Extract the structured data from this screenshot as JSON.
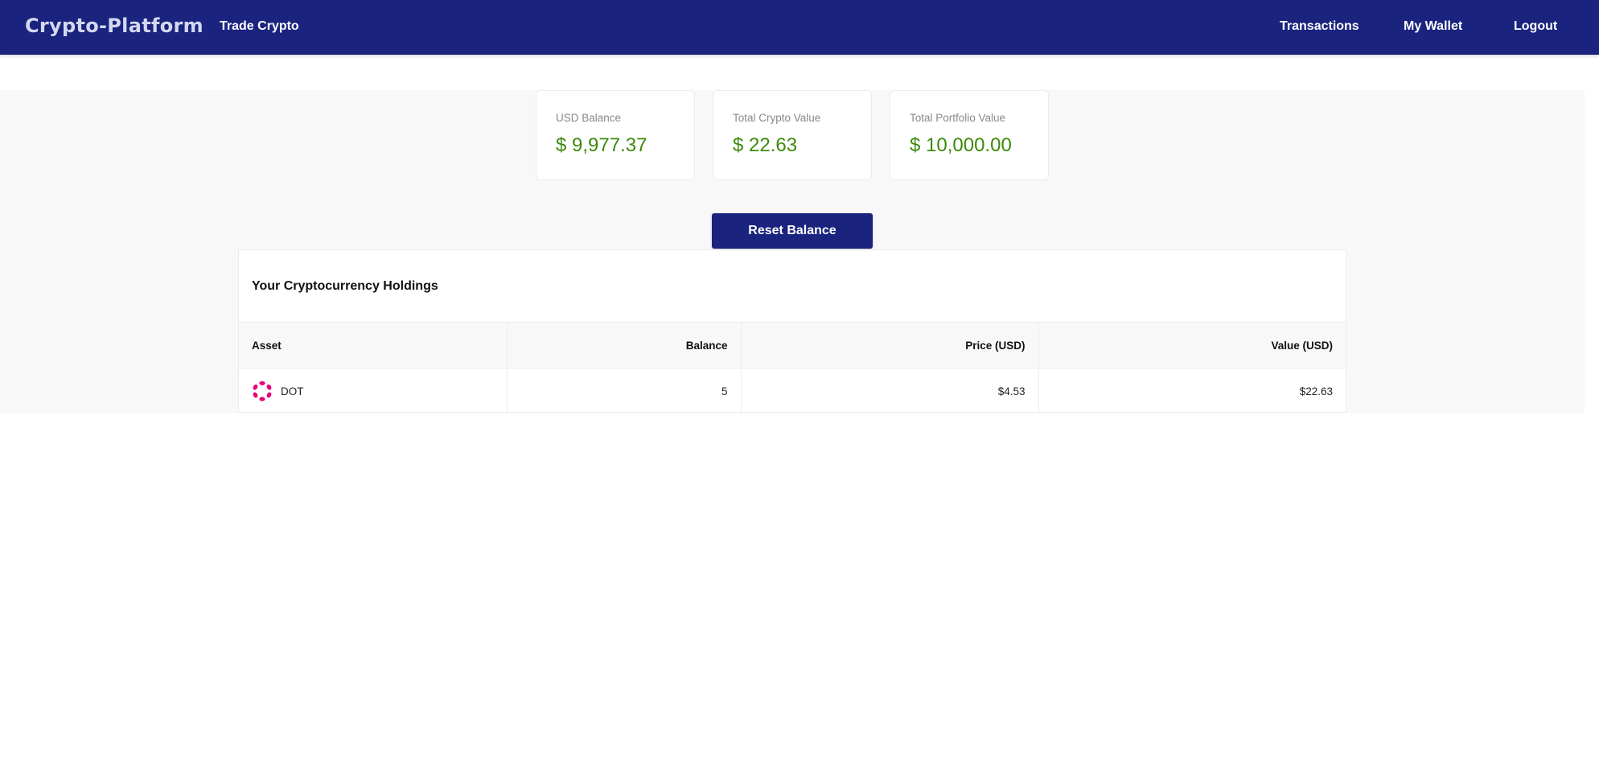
{
  "navbar": {
    "brand": "Crypto-Platform",
    "trade_link": "Trade Crypto",
    "transactions_link": "Transactions",
    "wallet_link": "My Wallet",
    "logout_link": "Logout"
  },
  "summary": {
    "usd_balance": {
      "label": "USD Balance",
      "value": "$ 9,977.37"
    },
    "crypto_value": {
      "label": "Total Crypto Value",
      "value": "$ 22.63"
    },
    "portfolio_value": {
      "label": "Total Portfolio Value",
      "value": "$ 10,000.00"
    }
  },
  "reset_button": "Reset Balance",
  "holdings": {
    "title": "Your Cryptocurrency Holdings",
    "columns": [
      "Asset",
      "Balance",
      "Price (USD)",
      "Value (USD)"
    ],
    "rows": [
      {
        "icon": "polkadot-icon",
        "asset": "DOT",
        "balance": "5",
        "price": "$4.53",
        "value": "$22.63"
      }
    ]
  },
  "colors": {
    "primary": "#1a237e",
    "positive": "#3c8a0a",
    "polkadot": "#e6007a"
  }
}
